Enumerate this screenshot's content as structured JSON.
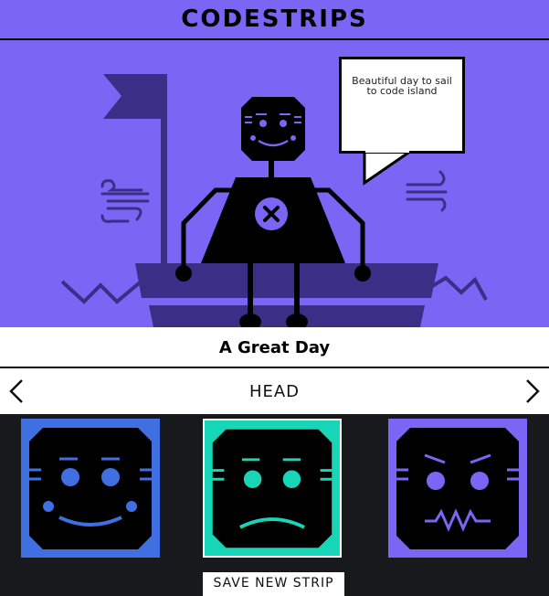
{
  "app": {
    "title": "CODESTRIPS"
  },
  "scene": {
    "speech_bubble": "Beautiful day to sail to code island"
  },
  "strip": {
    "title": "A Great Day"
  },
  "part_picker": {
    "label": "HEAD",
    "prev_icon": "chevron-left-icon",
    "next_icon": "chevron-right-icon"
  },
  "options": [
    {
      "name": "happy-head",
      "color": "#3f6fe0",
      "selected": false
    },
    {
      "name": "sad-head",
      "color": "#17d6b8",
      "selected": true
    },
    {
      "name": "angry-head",
      "color": "#7a65f5",
      "selected": false
    }
  ],
  "actions": {
    "save_label": "SAVE NEW STRIP"
  },
  "colors": {
    "accent": "#7a65f5",
    "boat": "#3a2f86",
    "dark": "#17191c"
  }
}
